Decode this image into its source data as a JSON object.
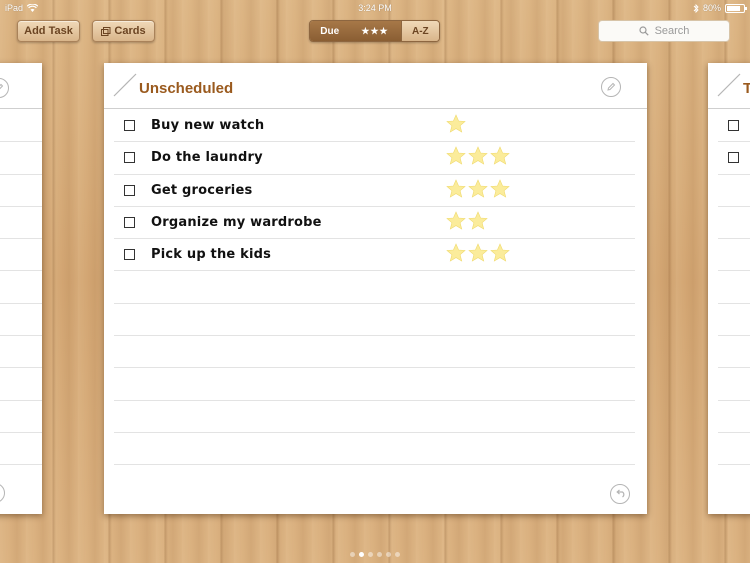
{
  "status_bar": {
    "device": "iPad",
    "time": "3:24 PM",
    "battery": "80%",
    "battery_level": 0.8
  },
  "toolbar": {
    "add_task_label": "Add Task",
    "cards_label": "Cards",
    "sort_options": [
      "Due",
      "★★★",
      "A-Z"
    ],
    "sort_active_index": 0,
    "search_placeholder": "Search"
  },
  "card": {
    "title": "Unscheduled",
    "tasks": [
      {
        "label": "Buy new  watch",
        "stars": 1
      },
      {
        "label": "Do the laundry",
        "stars": 3
      },
      {
        "label": "Get groceries",
        "stars": 3
      },
      {
        "label": "Organize my wardrobe",
        "stars": 2
      },
      {
        "label": "Pick up the kids",
        "stars": 3
      }
    ],
    "total_rows": 11
  },
  "right_peek": {
    "title_initial": "T"
  },
  "page_dots": {
    "count": 6,
    "active_index": 1
  },
  "colors": {
    "accent": "#9a5a1e",
    "star": "#fbec9b"
  }
}
